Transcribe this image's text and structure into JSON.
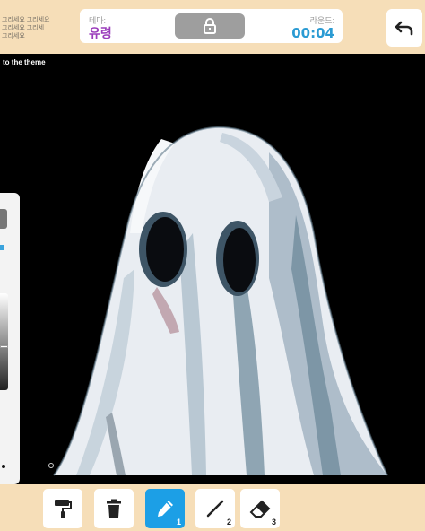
{
  "header": {
    "theme_label": "테마:",
    "theme_value": "유령",
    "round_label": "라운드:",
    "timer": "00:04",
    "corner_lines": [
      "그리세요 그리세요",
      "그리세요 그리세",
      "그리세요"
    ]
  },
  "canvas": {
    "prompt": "to the theme"
  },
  "toolbar": {
    "tools": [
      {
        "name": "fill",
        "number": ""
      },
      {
        "name": "trash",
        "number": ""
      },
      {
        "name": "pencil",
        "number": "1"
      },
      {
        "name": "line",
        "number": "2"
      },
      {
        "name": "eraser",
        "number": "3"
      }
    ]
  },
  "colors": {
    "background": "#f6deb8",
    "theme_value": "#9b3dbb",
    "timer": "#2b9bd3",
    "active_tool": "#1c9fe6",
    "canvas": "#000000"
  }
}
